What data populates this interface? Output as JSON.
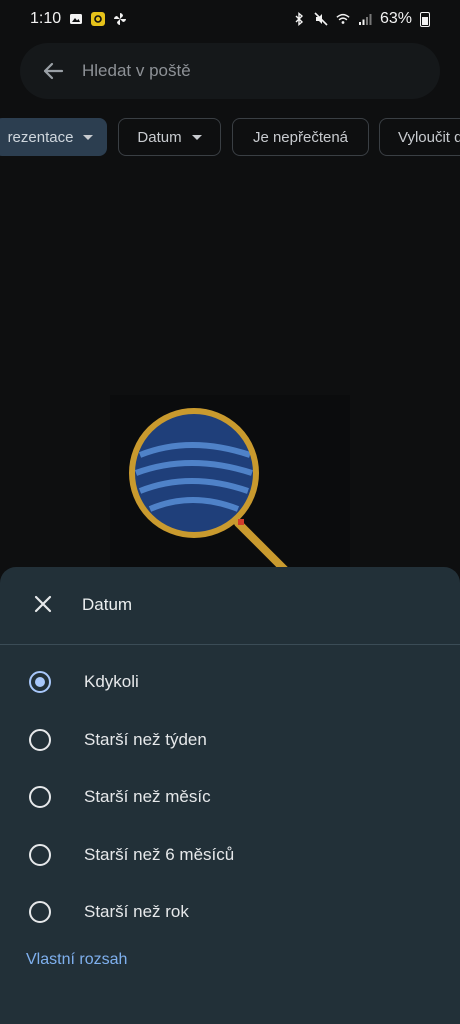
{
  "status_bar": {
    "time": "1:10",
    "battery": "63%",
    "left_icons": [
      "image-icon",
      "notification-app-icon",
      "pinwheel-icon"
    ],
    "right_icons": [
      "bluetooth-icon",
      "mute-icon",
      "wifi-icon",
      "signal-icon",
      "battery-icon"
    ]
  },
  "search": {
    "placeholder": "Hledat v poště"
  },
  "filters": [
    {
      "label": "rezentace",
      "has_dropdown": true,
      "active": true
    },
    {
      "label": "Datum",
      "has_dropdown": true,
      "active": false
    },
    {
      "label": "Je nepřečtená",
      "has_dropdown": false,
      "active": false
    },
    {
      "label": "Vyloučit d",
      "has_dropdown": false,
      "active": false
    }
  ],
  "sheet": {
    "title": "Datum",
    "options": [
      {
        "label": "Kdykoli",
        "selected": true
      },
      {
        "label": "Starší než týden",
        "selected": false
      },
      {
        "label": "Starší než měsíc",
        "selected": false
      },
      {
        "label": "Starší než 6 měsíců",
        "selected": false
      },
      {
        "label": "Starší než rok",
        "selected": false
      }
    ],
    "custom_range_label": "Vlastní rozsah"
  },
  "colors": {
    "background": "#0e0f10",
    "sheet_background": "#223038",
    "accent": "#a8c7fa",
    "link": "#7fb0ee"
  }
}
